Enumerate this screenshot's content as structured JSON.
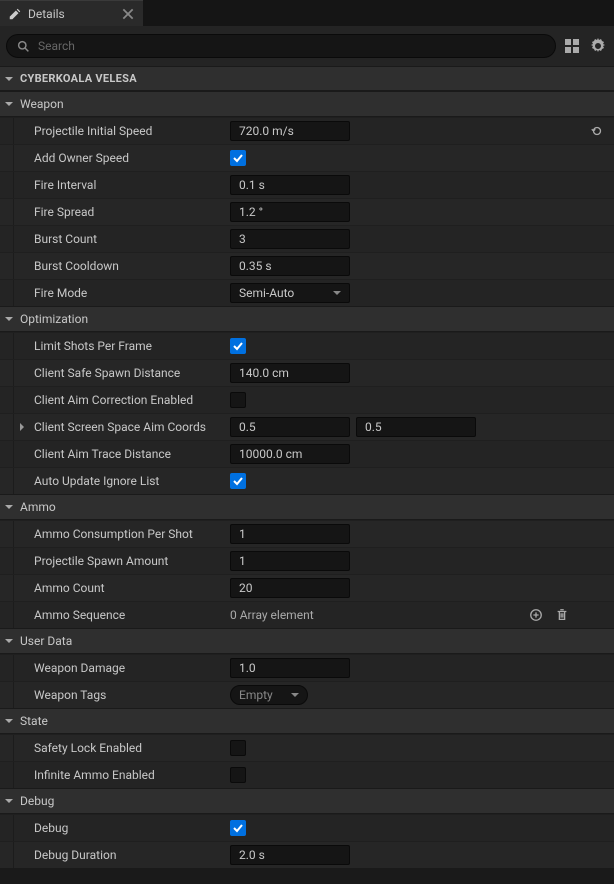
{
  "tab": {
    "title": "Details"
  },
  "search": {
    "placeholder": "Search"
  },
  "top_section": "CYBERKOALA VELESA",
  "sections": {
    "weapon": {
      "title": "Weapon",
      "projectile_initial_speed": {
        "label": "Projectile Initial Speed",
        "value": "720.0 m/s"
      },
      "add_owner_speed": {
        "label": "Add Owner Speed",
        "checked": true
      },
      "fire_interval": {
        "label": "Fire Interval",
        "value": "0.1 s"
      },
      "fire_spread": {
        "label": "Fire Spread",
        "value": "1.2 °"
      },
      "burst_count": {
        "label": "Burst Count",
        "value": "3"
      },
      "burst_cooldown": {
        "label": "Burst Cooldown",
        "value": "0.35 s"
      },
      "fire_mode": {
        "label": "Fire Mode",
        "value": "Semi-Auto"
      }
    },
    "optimization": {
      "title": "Optimization",
      "limit_shots": {
        "label": "Limit Shots Per Frame",
        "checked": true
      },
      "client_safe_spawn": {
        "label": "Client Safe Spawn Distance",
        "value": "140.0 cm"
      },
      "client_aim_correction": {
        "label": "Client Aim Correction Enabled",
        "checked": false
      },
      "client_screen_coords": {
        "label": "Client Screen Space Aim Coords",
        "x": "0.5",
        "y": "0.5"
      },
      "client_aim_trace": {
        "label": "Client Aim Trace Distance",
        "value": "10000.0 cm"
      },
      "auto_update_ignore": {
        "label": "Auto Update Ignore List",
        "checked": true
      }
    },
    "ammo": {
      "title": "Ammo",
      "consumption": {
        "label": "Ammo Consumption Per Shot",
        "value": "1"
      },
      "spawn_amount": {
        "label": "Projectile Spawn Amount",
        "value": "1"
      },
      "count": {
        "label": "Ammo Count",
        "value": "20"
      },
      "sequence": {
        "label": "Ammo Sequence",
        "value": "0 Array element"
      }
    },
    "user_data": {
      "title": "User Data",
      "damage": {
        "label": "Weapon Damage",
        "value": "1.0"
      },
      "tags": {
        "label": "Weapon Tags",
        "value": "Empty"
      }
    },
    "state": {
      "title": "State",
      "safety_lock": {
        "label": "Safety Lock Enabled",
        "checked": false
      },
      "infinite_ammo": {
        "label": "Infinite Ammo Enabled",
        "checked": false
      }
    },
    "debug": {
      "title": "Debug",
      "debug": {
        "label": "Debug",
        "checked": true
      },
      "duration": {
        "label": "Debug Duration",
        "value": "2.0 s"
      }
    }
  }
}
